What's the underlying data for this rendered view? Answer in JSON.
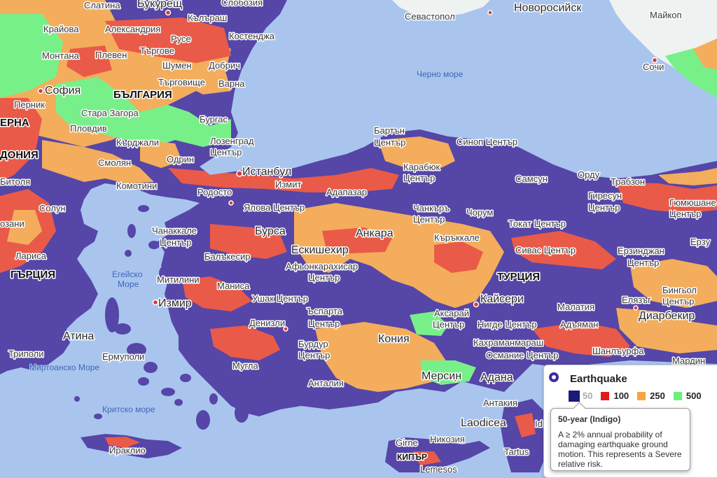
{
  "map": {
    "countries": [
      {
        "id": "bulgaria",
        "label": "БЪЛГАРИЯ"
      },
      {
        "id": "turkey",
        "label": "ТУРЦИЯ"
      },
      {
        "id": "greece",
        "label": "ГЪРЦИЯ"
      },
      {
        "id": "cyprus",
        "label": "КИПЪР"
      },
      {
        "id": "macedonia1",
        "label": "ЕРНА"
      },
      {
        "id": "macedonia2",
        "label": "ДОНИЯ"
      }
    ],
    "seas": [
      {
        "id": "black-sea",
        "label": "Черно море"
      },
      {
        "id": "aegean1",
        "label": "Егейско"
      },
      {
        "id": "aegean2",
        "label": "Море"
      },
      {
        "id": "myrtoan",
        "label": "Миртоанско Море"
      },
      {
        "id": "cretan",
        "label": "Критско море"
      }
    ],
    "cities": [
      {
        "id": "slatina",
        "label": "Слатина"
      },
      {
        "id": "bucharest",
        "label": "Букурещ"
      },
      {
        "id": "slobozia",
        "label": "Слобозия"
      },
      {
        "id": "craiova",
        "label": "Крайова"
      },
      {
        "id": "alexandria",
        "label": "Александрия"
      },
      {
        "id": "calarasi",
        "label": "Кълъраш"
      },
      {
        "id": "constanta",
        "label": "Костенджа"
      },
      {
        "id": "montana",
        "label": "Монтана"
      },
      {
        "id": "pleven",
        "label": "Плевен"
      },
      {
        "id": "ruse",
        "label": "Русе"
      },
      {
        "id": "targovishte-ro",
        "label": "Търгове"
      },
      {
        "id": "dobrich",
        "label": "Добрич"
      },
      {
        "id": "shumen",
        "label": "Шумен"
      },
      {
        "id": "varna",
        "label": "Варна"
      },
      {
        "id": "targovishte",
        "label": "Търговище"
      },
      {
        "id": "sofia",
        "label": "София"
      },
      {
        "id": "pernik",
        "label": "Перник"
      },
      {
        "id": "stara-zagora",
        "label": "Стара Загора"
      },
      {
        "id": "burgas",
        "label": "Бургас"
      },
      {
        "id": "plovdiv",
        "label": "Пловдив"
      },
      {
        "id": "kardzhali",
        "label": "Кърджали"
      },
      {
        "id": "smolyan",
        "label": "Смолян"
      },
      {
        "id": "edirne",
        "label": "Одрин"
      },
      {
        "id": "lozengrad1",
        "label": "Лозенград"
      },
      {
        "id": "lozengrad2",
        "label": "Център"
      },
      {
        "id": "komotini",
        "label": "Комотини"
      },
      {
        "id": "bitola",
        "label": "Битоля"
      },
      {
        "id": "solun",
        "label": "Солун"
      },
      {
        "id": "kozani",
        "label": "озани"
      },
      {
        "id": "larisa",
        "label": "Лариса"
      },
      {
        "id": "istanbul",
        "label": "Истанбул"
      },
      {
        "id": "izmit",
        "label": "Измит"
      },
      {
        "id": "rodosto",
        "label": "Родосто"
      },
      {
        "id": "adapazari",
        "label": "Адапазар"
      },
      {
        "id": "yalova",
        "label": "Ялова Център"
      },
      {
        "id": "bursa",
        "label": "Бурса"
      },
      {
        "id": "canakkale1",
        "label": "Чанаккале"
      },
      {
        "id": "canakkale2",
        "label": "Център"
      },
      {
        "id": "balikesir",
        "label": "Балъкесир"
      },
      {
        "id": "eskisehir",
        "label": "Ескишехир"
      },
      {
        "id": "ankara",
        "label": "Анкара"
      },
      {
        "id": "afyon1",
        "label": "Афьонкарахисар"
      },
      {
        "id": "afyon2",
        "label": "Център"
      },
      {
        "id": "mitilini",
        "label": "Митилини"
      },
      {
        "id": "manisa",
        "label": "Маниса"
      },
      {
        "id": "izmir",
        "label": "Измир"
      },
      {
        "id": "usak",
        "label": "Ушак Център"
      },
      {
        "id": "isparta1",
        "label": "Ъспарта"
      },
      {
        "id": "isparta2",
        "label": "Център"
      },
      {
        "id": "denizli",
        "label": "Денизли"
      },
      {
        "id": "burdur1",
        "label": "Бурдур"
      },
      {
        "id": "burdur2",
        "label": "Център"
      },
      {
        "id": "konya",
        "label": "Кония"
      },
      {
        "id": "mugla",
        "label": "Мугла"
      },
      {
        "id": "antalya",
        "label": "Анталия"
      },
      {
        "id": "athens",
        "label": "Атина"
      },
      {
        "id": "tripoli",
        "label": "Триполи"
      },
      {
        "id": "ermoupoli",
        "label": "Ермуполи"
      },
      {
        "id": "iraklio",
        "label": "Ираклио"
      },
      {
        "id": "bartin1",
        "label": "Бартън"
      },
      {
        "id": "bartin2",
        "label": "Център"
      },
      {
        "id": "sinop",
        "label": "Синоп Център"
      },
      {
        "id": "karabuk1",
        "label": "Карабюк"
      },
      {
        "id": "karabuk2",
        "label": "Център"
      },
      {
        "id": "samsun",
        "label": "Самсун"
      },
      {
        "id": "ordu",
        "label": "Орду"
      },
      {
        "id": "trabzon",
        "label": "Трабзон"
      },
      {
        "id": "giresun1",
        "label": "Гиресун"
      },
      {
        "id": "giresun2",
        "label": "Център"
      },
      {
        "id": "gumushane1",
        "label": "Гюмюшане"
      },
      {
        "id": "gumushane2",
        "label": "Център"
      },
      {
        "id": "cankiri1",
        "label": "Чанкъръ"
      },
      {
        "id": "cankiri2",
        "label": "Център"
      },
      {
        "id": "corum",
        "label": "Чорум"
      },
      {
        "id": "kirikkale",
        "label": "Къръккале"
      },
      {
        "id": "tokat",
        "label": "Токат Център"
      },
      {
        "id": "sivas",
        "label": "Сивас Център"
      },
      {
        "id": "erzincan1",
        "label": "Ерзинджан"
      },
      {
        "id": "erzincan2",
        "label": "Център"
      },
      {
        "id": "erzurum",
        "label": "Ерзу"
      },
      {
        "id": "kayseri",
        "label": "Кайсери"
      },
      {
        "id": "aksaray1",
        "label": "Аксарай"
      },
      {
        "id": "aksaray2",
        "label": "Център"
      },
      {
        "id": "nigde",
        "label": "Нигде Център"
      },
      {
        "id": "malatya",
        "label": "Малатия"
      },
      {
        "id": "elazig",
        "label": "Елязъг"
      },
      {
        "id": "bingol1",
        "label": "Бингьол"
      },
      {
        "id": "bingol2",
        "label": "Център"
      },
      {
        "id": "diyarbakir",
        "label": "Диарбекир"
      },
      {
        "id": "adiyaman",
        "label": "Адъяман"
      },
      {
        "id": "kahramanmaras",
        "label": "Кахраманмараш"
      },
      {
        "id": "osmaniye",
        "label": "Османие Център"
      },
      {
        "id": "sanliurfa",
        "label": "Шанлъурфа"
      },
      {
        "id": "mardin",
        "label": "Мардин"
      },
      {
        "id": "mersin",
        "label": "Мерсин"
      },
      {
        "id": "adana",
        "label": "Адана"
      },
      {
        "id": "antakya",
        "label": "Антакия"
      },
      {
        "id": "laodicea",
        "label": "Laodicea"
      },
      {
        "id": "girne",
        "label": "Girne"
      },
      {
        "id": "nicosia",
        "label": "Никозия"
      },
      {
        "id": "tartus",
        "label": "Tartus"
      },
      {
        "id": "lemesos",
        "label": "Lemesos"
      },
      {
        "id": "sevastopol",
        "label": "Севастопол"
      },
      {
        "id": "novorossiysk",
        "label": "Новоросийск"
      },
      {
        "id": "maykop",
        "label": "Майкоп"
      },
      {
        "id": "sochi",
        "label": "Сочи"
      },
      {
        "id": "idlib",
        "label": "Id"
      }
    ]
  },
  "legend": {
    "title": "Earthquake",
    "levels": [
      {
        "label": "50",
        "color": "#1a1a7a",
        "active": true
      },
      {
        "label": "100",
        "color": "#e01b1b",
        "active": false
      },
      {
        "label": "250",
        "color": "#f5a545",
        "active": false
      },
      {
        "label": "500",
        "color": "#6af07a",
        "active": false
      }
    ]
  },
  "tooltip": {
    "title": "50-year (Indigo)",
    "body": "A ≥ 2% annual probability of damaging earthquake ground motion. This represents a Severe relative risk."
  },
  "colors": {
    "water": "#a9c5ee",
    "indigo": "#5546a8",
    "red": "#ea5a48",
    "orange": "#f3ad5c",
    "green": "#78f08a",
    "land_light": "#eef2f0"
  }
}
